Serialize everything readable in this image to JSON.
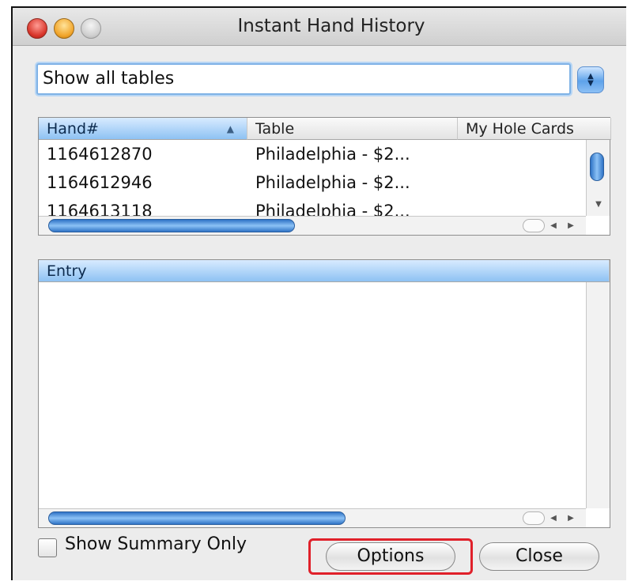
{
  "window": {
    "title": "Instant Hand History"
  },
  "filter": {
    "selected": "Show all tables"
  },
  "hands_table": {
    "columns": [
      "Hand#",
      "Table",
      "My Hole Cards"
    ],
    "sorted_column": "Hand#",
    "sort_direction": "ascending",
    "rows": [
      {
        "hand": "1164612870",
        "table": "Philadelphia - $2..."
      },
      {
        "hand": "1164612946",
        "table": "Philadelphia - $2..."
      },
      {
        "hand": "1164613118",
        "table": "Philadelphia - $2..."
      }
    ]
  },
  "entry_table": {
    "columns": [
      "Entry"
    ]
  },
  "footer": {
    "show_summary_label": "Show Summary Only",
    "show_summary_checked": false,
    "options_label": "Options",
    "close_label": "Close"
  },
  "colors": {
    "accent": "#5ea2ea",
    "highlight": "#e0202a"
  }
}
